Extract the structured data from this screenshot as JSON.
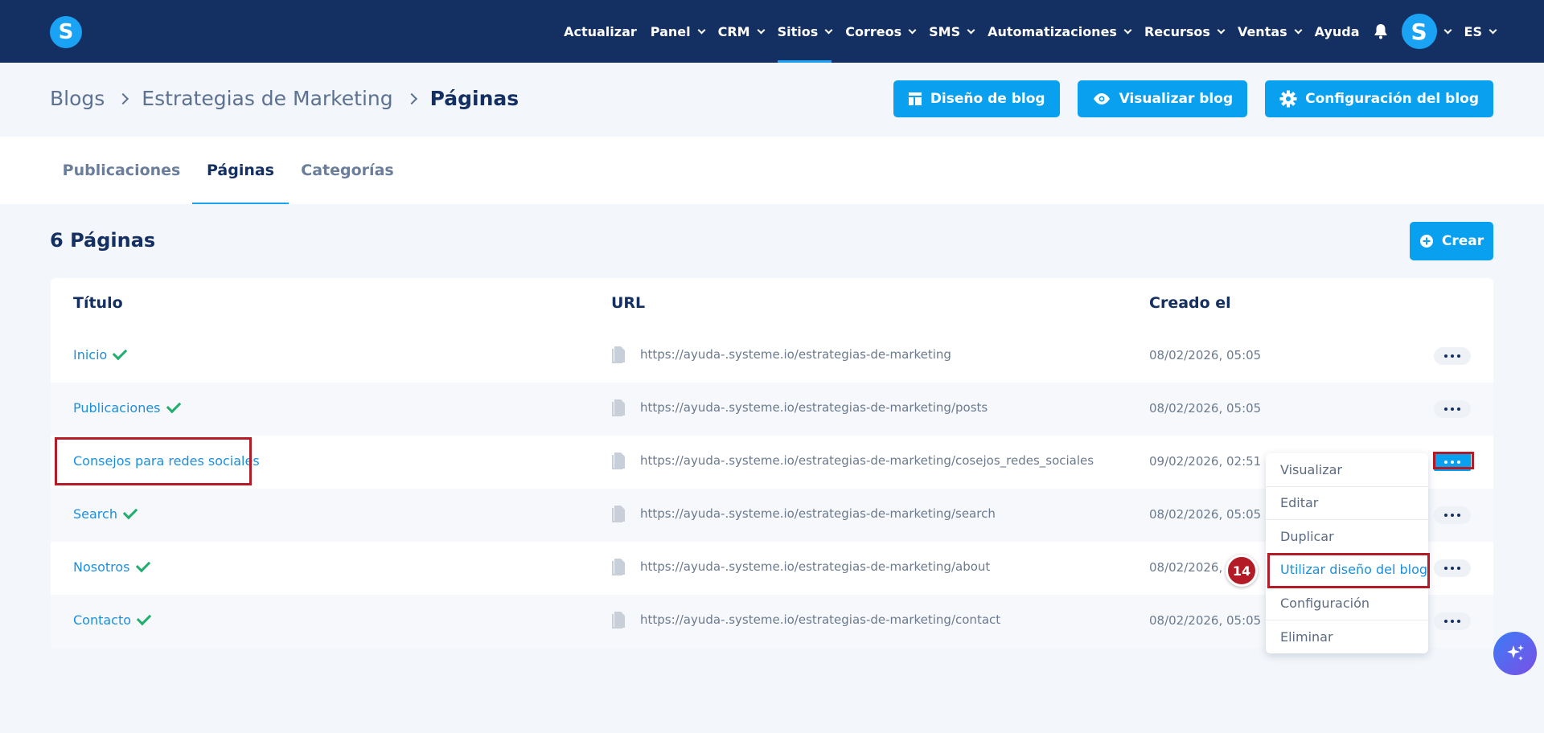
{
  "topnav": {
    "logo_letter": "S",
    "items": [
      {
        "label": "Actualizar",
        "chevron": false
      },
      {
        "label": "Panel",
        "chevron": true
      },
      {
        "label": "CRM",
        "chevron": true
      },
      {
        "label": "Sitios",
        "chevron": true,
        "active": true
      },
      {
        "label": "Correos",
        "chevron": true
      },
      {
        "label": "SMS",
        "chevron": true
      },
      {
        "label": "Automatizaciones",
        "chevron": true
      },
      {
        "label": "Recursos",
        "chevron": true
      },
      {
        "label": "Ventas",
        "chevron": true
      },
      {
        "label": "Ayuda",
        "chevron": false
      }
    ],
    "avatar_letter": "S",
    "language": "ES"
  },
  "breadcrumb": {
    "items": [
      "Blogs",
      "Estrategias de Marketing"
    ],
    "current": "Páginas"
  },
  "header_buttons": {
    "design": "Diseño de blog",
    "preview": "Visualizar blog",
    "settings": "Configuración del blog"
  },
  "tabs": [
    "Publicaciones",
    "Páginas",
    "Categorías"
  ],
  "active_tab": "Páginas",
  "page_count": {
    "number": "6",
    "label": "Páginas"
  },
  "create_label": "Crear",
  "table": {
    "columns": [
      "Título",
      "URL",
      "Creado el"
    ],
    "rows": [
      {
        "title": "Inicio",
        "check": true,
        "url": "https://ayuda-.systeme.io/estrategias-de-marketing",
        "date": "08/02/2026, 05:05"
      },
      {
        "title": "Publicaciones",
        "check": true,
        "url": "https://ayuda-.systeme.io/estrategias-de-marketing/posts",
        "date": "08/02/2026, 05:05"
      },
      {
        "title": "Consejos para redes sociales",
        "check": false,
        "url": "https://ayuda-.systeme.io/estrategias-de-marketing/cosejos_redes_sociales",
        "date": "09/02/2026, 02:51"
      },
      {
        "title": "Search",
        "check": true,
        "url": "https://ayuda-.systeme.io/estrategias-de-marketing/search",
        "date": "08/02/2026, 05:05"
      },
      {
        "title": "Nosotros",
        "check": true,
        "url": "https://ayuda-.systeme.io/estrategias-de-marketing/about",
        "date": "08/02/2026,"
      },
      {
        "title": "Contacto",
        "check": true,
        "url": "https://ayuda-.systeme.io/estrategias-de-marketing/contact",
        "date": "08/02/2026, 05:05"
      }
    ]
  },
  "menu": {
    "items": [
      "Visualizar",
      "Editar",
      "Duplicar",
      "Utilizar diseño del blog",
      "Configuración",
      "Eliminar"
    ],
    "highlighted": "Utilizar diseño del blog"
  },
  "step_badge": "14",
  "colors": {
    "nav_bg": "#142f62",
    "accent": "#0aa0f0",
    "annotation_red": "#b31b26",
    "success": "#1fae6b"
  }
}
